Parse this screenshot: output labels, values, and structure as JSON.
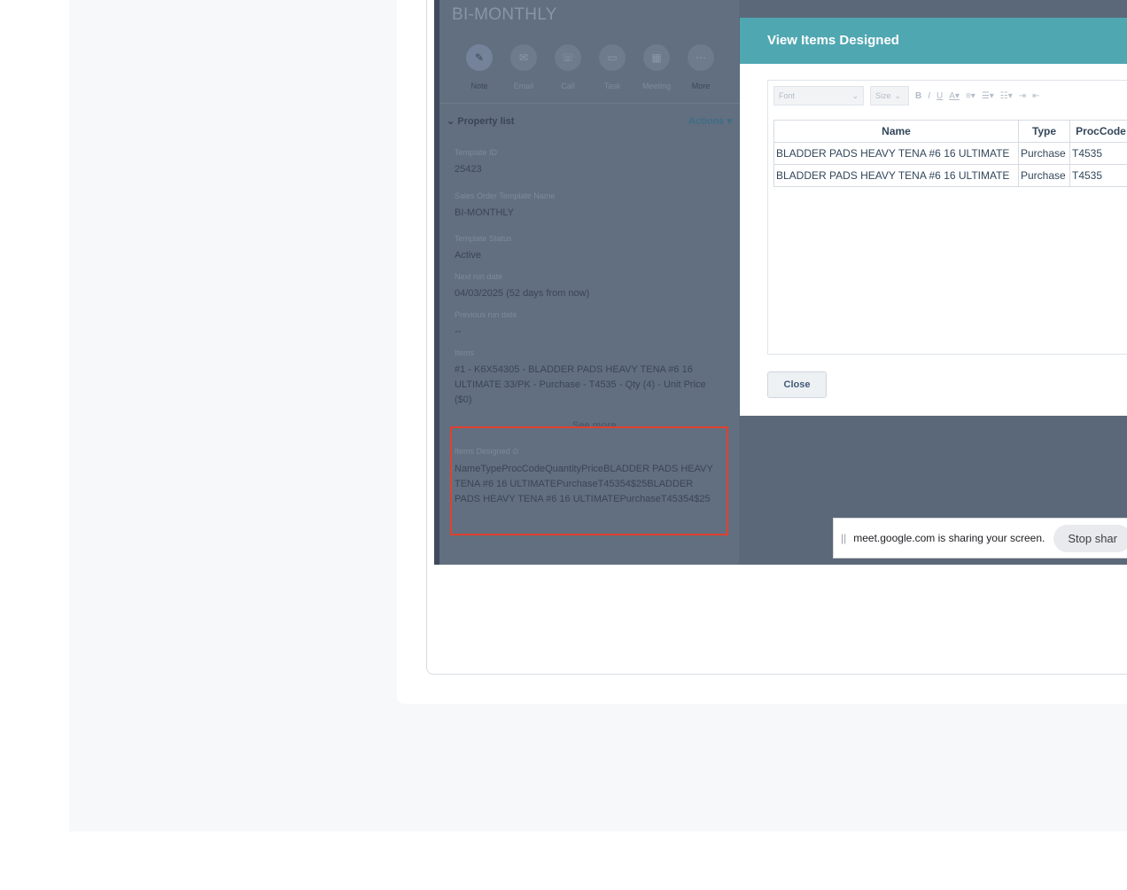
{
  "record": {
    "title": "BI-MONTHLY",
    "actions": [
      {
        "label": "Note",
        "icon": "note-icon"
      },
      {
        "label": "Email",
        "icon": "email-icon"
      },
      {
        "label": "Call",
        "icon": "phone-icon"
      },
      {
        "label": "Task",
        "icon": "task-icon"
      },
      {
        "label": "Meeting",
        "icon": "calendar-icon"
      },
      {
        "label": "More",
        "icon": "more-icon"
      }
    ],
    "property_list": {
      "heading": "Property list",
      "actions_label": "Actions",
      "properties": [
        {
          "label": "Template ID",
          "value": "25423"
        },
        {
          "label": "Sales Order Template Name",
          "value": "BI-MONTHLY"
        },
        {
          "label": "Template Status",
          "value": "Active"
        },
        {
          "label": "Next run date",
          "value": "04/03/2025 (52 days from now)"
        },
        {
          "label": "Previous run date",
          "value": "--"
        },
        {
          "label": "Items",
          "value": "#1 - K6X54305 - BLADDER PADS HEAVY TENA #6 16 ULTIMATE 33/PK - Purchase - T4535 - Qty (4) - Unit Price ($0)"
        },
        {
          "label": "Items Designed",
          "value": "NameTypeProcCodeQuantityPriceBLADDER PADS HEAVY TENA #6 16 ULTIMATEPurchaseT45354$25BLADDER PADS HEAVY TENA #6 16 ULTIMATEPurchaseT45354$25"
        }
      ],
      "see_more": "See more"
    }
  },
  "modal": {
    "title": "View Items Designed",
    "toolbar": {
      "font_placeholder": "Font",
      "size_placeholder": "Size"
    },
    "table": {
      "headers": [
        "Name",
        "Type",
        "ProcCode"
      ],
      "rows": [
        [
          "BLADDER PADS HEAVY TENA #6 16 ULTIMATE",
          "Purchase",
          "T4535"
        ],
        [
          "BLADDER PADS HEAVY TENA #6 16 ULTIMATE",
          "Purchase",
          "T4535"
        ]
      ]
    },
    "close_label": "Close"
  },
  "share_bar": {
    "message": "meet.google.com is sharing your screen.",
    "stop_label": "Stop shar"
  },
  "colors": {
    "modal_header": "#4fa7b1",
    "highlight_border": "#e0412f"
  }
}
